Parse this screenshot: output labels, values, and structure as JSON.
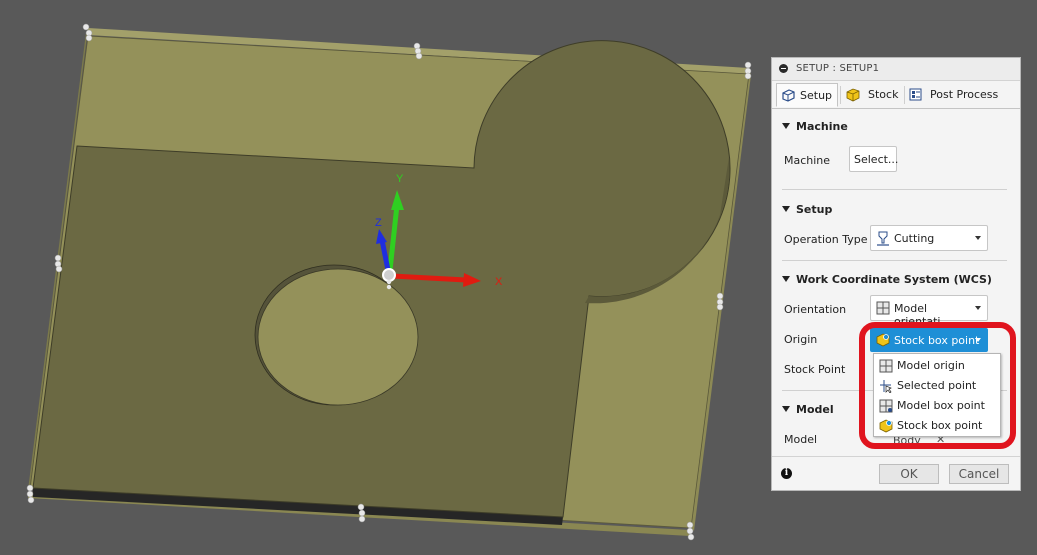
{
  "viewport": {
    "axis_labels": {
      "x": "X",
      "y": "Y",
      "z": "Z"
    },
    "colors": {
      "background": "#595959",
      "stock_top": "#94915a",
      "part_top": "#6b6943",
      "x_axis": "#e01b10",
      "y_axis": "#2fcf21",
      "z_axis": "#1f2ee0"
    }
  },
  "panel": {
    "title": "SETUP : SETUP1",
    "tabs": [
      {
        "label": "Setup",
        "icon": "setup-icon",
        "active": true
      },
      {
        "label": "Stock",
        "icon": "stock-cube-icon",
        "active": false
      },
      {
        "label": "Post Process",
        "icon": "post-process-icon",
        "active": false
      }
    ],
    "machine_section": {
      "title": "Machine",
      "machine_label": "Machine",
      "select_button": "Select..."
    },
    "setup_section": {
      "title": "Setup",
      "operation_type_label": "Operation Type",
      "operation_type_value": "Cutting"
    },
    "wcs_section": {
      "title": "Work Coordinate System (WCS)",
      "orientation_label": "Orientation",
      "orientation_value": "Model orientati...",
      "origin_label": "Origin",
      "origin_value": "Stock box point",
      "stock_point_label": "Stock Point"
    },
    "model_section": {
      "title": "Model",
      "model_label": "Model",
      "model_value_partial": "Body"
    },
    "origin_dropdown": [
      {
        "label": "Model origin",
        "icon": "model-origin-icon"
      },
      {
        "label": "Selected point",
        "icon": "selected-point-icon"
      },
      {
        "label": "Model box point",
        "icon": "model-box-point-icon"
      },
      {
        "label": "Stock box point",
        "icon": "stock-box-point-icon"
      }
    ],
    "footer": {
      "ok_label": "OK",
      "cancel_label": "Cancel"
    },
    "accent_color": "#1e8fd6",
    "highlight_color": "#e0141e"
  }
}
